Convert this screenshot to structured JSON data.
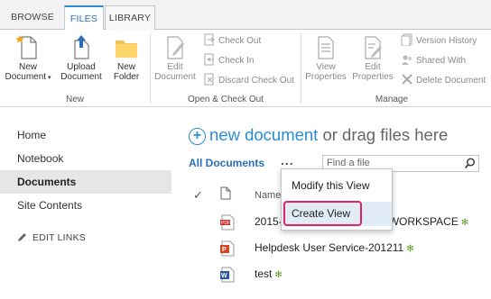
{
  "tabs": [
    {
      "label": "BROWSE"
    },
    {
      "label": "FILES"
    },
    {
      "label": "LIBRARY"
    }
  ],
  "ribbon": {
    "new_group": {
      "label": "New",
      "new_document": "New Document",
      "upload_document": "Upload Document",
      "new_folder": "New Folder"
    },
    "open_group": {
      "label": "Open & Check Out",
      "edit_document": "Edit Document",
      "check_out": "Check Out",
      "check_in": "Check In",
      "discard_check_out": "Discard Check Out"
    },
    "manage_group": {
      "label": "Manage",
      "view_properties": "View Properties",
      "edit_properties": "Edit Properties",
      "version_history": "Version History",
      "shared_with": "Shared With",
      "delete_document": "Delete Document"
    }
  },
  "nav": {
    "items": [
      {
        "label": "Home"
      },
      {
        "label": "Notebook"
      },
      {
        "label": "Documents"
      },
      {
        "label": "Site Contents"
      }
    ],
    "edit_links": "EDIT LINKS"
  },
  "main": {
    "new_document_link": "new document",
    "new_document_suffix": " or drag files here",
    "view_name": "All Documents",
    "more_label": "...",
    "search_placeholder": "Find a file",
    "column_name": "Name"
  },
  "files": [
    {
      "name_start": "2015-",
      "name_end": "WORKSPACE",
      "type": "pdf"
    },
    {
      "name": "Helpdesk User Service-201211",
      "type": "ppt"
    },
    {
      "name": "test",
      "type": "word"
    }
  ],
  "view_menu": {
    "items": [
      {
        "label": "Modify this View"
      },
      {
        "label": "Create View"
      }
    ]
  },
  "new_marker": "✻",
  "colors": {
    "accent": "#2a8dd4",
    "highlight": "#e0245e",
    "new_star": "#5a9b1e"
  }
}
